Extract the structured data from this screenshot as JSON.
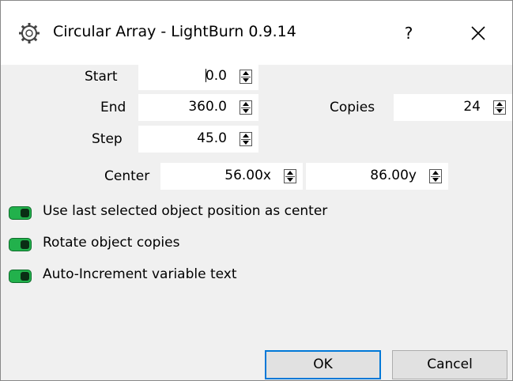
{
  "window": {
    "title": "Circular Array - LightBurn 0.9.14",
    "help_label": "?"
  },
  "fields": {
    "start": {
      "label": "Start",
      "value": "0.0"
    },
    "end": {
      "label": "End",
      "value": "360.0"
    },
    "step": {
      "label": "Step",
      "value": "45.0"
    },
    "copies": {
      "label": "Copies",
      "value": "24"
    },
    "center": {
      "label": "Center",
      "x": "56.00x",
      "y": "86.00y"
    }
  },
  "toggles": [
    {
      "label": "Use last selected object position as center",
      "on": true
    },
    {
      "label": "Rotate object copies",
      "on": true
    },
    {
      "label": "Auto-Increment variable text",
      "on": true
    }
  ],
  "buttons": {
    "ok": "OK",
    "cancel": "Cancel"
  },
  "colors": {
    "toggle_on": "#22b14c",
    "default_button_border": "#0078d7",
    "dialog_bg": "#f0f0f0"
  }
}
